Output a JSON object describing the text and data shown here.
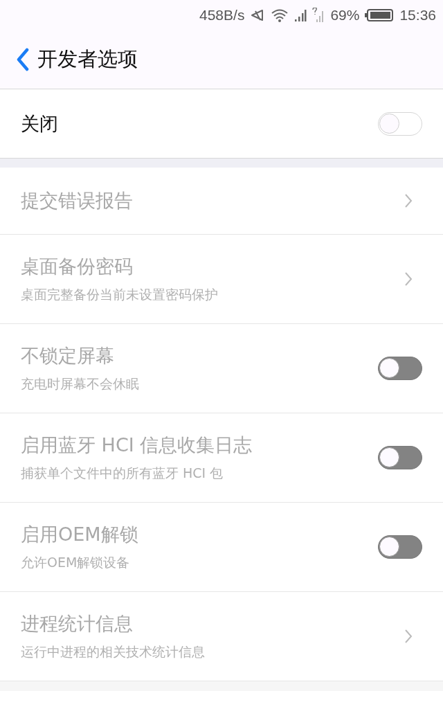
{
  "status_bar": {
    "speed": "458B/s",
    "battery": "69%",
    "time": "15:36"
  },
  "header": {
    "title": "开发者选项"
  },
  "master": {
    "label": "关闭",
    "on": false
  },
  "items": [
    {
      "kind": "link",
      "title": "提交错误报告",
      "disabled": true
    },
    {
      "kind": "link",
      "title": "桌面备份密码",
      "subtitle": "桌面完整备份当前未设置密码保护",
      "disabled": true
    },
    {
      "kind": "switch",
      "title": "不锁定屏幕",
      "subtitle": "充电时屏幕不会休眠",
      "on": false,
      "disabled": true
    },
    {
      "kind": "switch",
      "title": "启用蓝牙 HCI 信息收集日志",
      "subtitle": "捕获单个文件中的所有蓝牙 HCI 包",
      "on": false,
      "disabled": true
    },
    {
      "kind": "switch",
      "title": "启用OEM解锁",
      "subtitle": "允许OEM解锁设备",
      "on": false,
      "disabled": true
    },
    {
      "kind": "link",
      "title": "进程统计信息",
      "subtitle": "运行中进程的相关技术统计信息",
      "disabled": true
    }
  ]
}
